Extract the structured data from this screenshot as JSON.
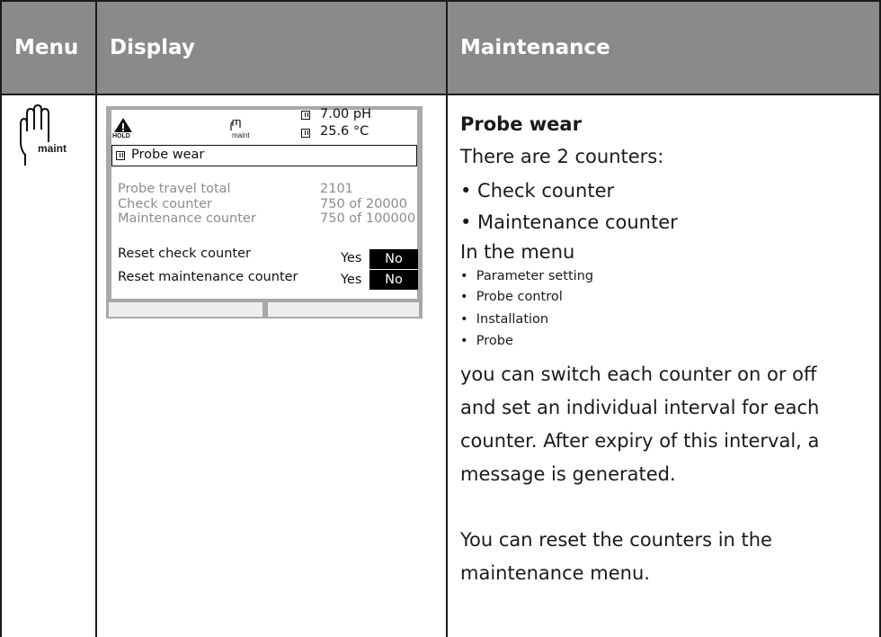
{
  "header": {
    "menu": "Menu",
    "display": "Display",
    "maintenance": "Maintenance"
  },
  "menu_icon": {
    "label": "maint",
    "icon": "hand-icon"
  },
  "display": {
    "status_icons": {
      "warning_label": "HOLD",
      "hand_label": "maint"
    },
    "readout_1": "7.00 pH",
    "readout_2": "25.6 °C",
    "title": "Probe wear",
    "rows": [
      {
        "label": "Probe travel total",
        "value": "2101"
      },
      {
        "label": "Check counter",
        "value": "750 of 20000"
      },
      {
        "label": "Maintenance counter",
        "value": "750 of 100000"
      }
    ],
    "reset_check": {
      "label": "Reset check counter",
      "yes": "Yes",
      "no": "No"
    },
    "reset_maint": {
      "label": "Reset maintenance counter",
      "yes": "Yes",
      "no": "No"
    }
  },
  "maintenance": {
    "heading": "Probe wear",
    "intro": "There are 2 counters:",
    "counters": [
      "• Check counter",
      "• Maintenance counter"
    ],
    "menu_intro": "In the menu",
    "menu_items": [
      "Parameter setting",
      "Probe control",
      "Installation",
      "Probe"
    ],
    "para_1": [
      "you can switch each counter on or off",
      "and set an individual interval for each",
      "counter. After expiry of this interval, a",
      "message is generated."
    ],
    "para_2": [
      "You can reset the counters in the",
      "maintenance menu."
    ]
  },
  "colors": {
    "header_bg": "#8a8a8a",
    "lcd_frame": "#a8a8a8",
    "text": "#1a1a1a"
  }
}
